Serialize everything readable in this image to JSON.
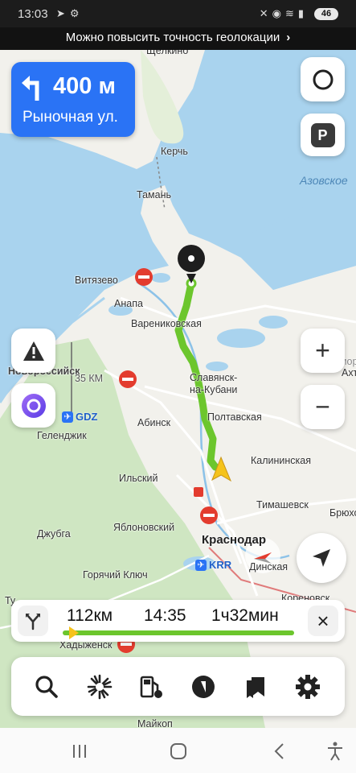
{
  "status_bar": {
    "time": "13:03",
    "left_icons": [
      "navigation-icon",
      "settings-icon"
    ],
    "right_icons": [
      "mute-icon",
      "location-icon",
      "wifi-icon",
      "signal-icon"
    ],
    "battery": "46"
  },
  "geo_banner": {
    "text": "Можно повысить точность геолокации",
    "chevron": "›"
  },
  "turn_card": {
    "distance": "400 м",
    "street": "Рыночная ул.",
    "direction": "left"
  },
  "map": {
    "places": [
      {
        "id": "shchelkino",
        "text": "Щёлкино"
      },
      {
        "id": "kerch",
        "text": "Керчь"
      },
      {
        "id": "taman",
        "text": "Тамань"
      },
      {
        "id": "vityazevo",
        "text": "Витязево"
      },
      {
        "id": "anapa",
        "text": "Анапа"
      },
      {
        "id": "varenikovskaya",
        "text": "Варениковская"
      },
      {
        "id": "novorossiysk",
        "text": "Новороссийск"
      },
      {
        "id": "slavyansk",
        "text": "Славянск-"
      },
      {
        "id": "slavyansk2",
        "text": "на-Кубани"
      },
      {
        "id": "poltavskaya",
        "text": "Полтавская"
      },
      {
        "id": "abinsk",
        "text": "Абинск"
      },
      {
        "id": "gelendzhik",
        "text": "Геленджик"
      },
      {
        "id": "ilsky",
        "text": "Ильский"
      },
      {
        "id": "kalininskaya",
        "text": "Калининская"
      },
      {
        "id": "timashevsk",
        "text": "Тимашевск"
      },
      {
        "id": "bryukh",
        "text": "Брюхо"
      },
      {
        "id": "yablonovsky",
        "text": "Яблоновский"
      },
      {
        "id": "dzhubga",
        "text": "Джубга"
      },
      {
        "id": "krasnodar",
        "text": "Краснодар"
      },
      {
        "id": "dinskaya",
        "text": "Динская"
      },
      {
        "id": "goryachiy",
        "text": "Горячий Ключ"
      },
      {
        "id": "tu",
        "text": "Ту"
      },
      {
        "id": "khadyzhensk",
        "text": "Хадыженск"
      },
      {
        "id": "maikop",
        "text": "Майкоп"
      },
      {
        "id": "primor",
        "text": "Примор"
      },
      {
        "id": "akht",
        "text": "Ахт"
      },
      {
        "id": "korenovsk",
        "text": "Кореновск"
      }
    ],
    "sea_label": "Азовское",
    "airports": [
      {
        "code": "GDZ"
      },
      {
        "code": "KRR"
      }
    ],
    "km_label": "35 КМ",
    "colors": {
      "water": "#a9d3ee",
      "land": "#f2f1ec",
      "forest": "#cfe6c2",
      "route": "#7fd321",
      "roads": "#ffffff"
    }
  },
  "controls": {
    "zoom_in": "+",
    "zoom_out": "−",
    "alice_icon": "alice-icon",
    "parking_label": "P"
  },
  "route": {
    "distance": "112км",
    "arrival": "14:35",
    "duration": "1ч32мин",
    "progress": 0.05,
    "close_label": "×"
  },
  "toolbar": {
    "items": [
      "search-icon",
      "explore-icon",
      "gas-station-icon",
      "music-icon",
      "bookmarks-icon",
      "settings-icon"
    ]
  }
}
